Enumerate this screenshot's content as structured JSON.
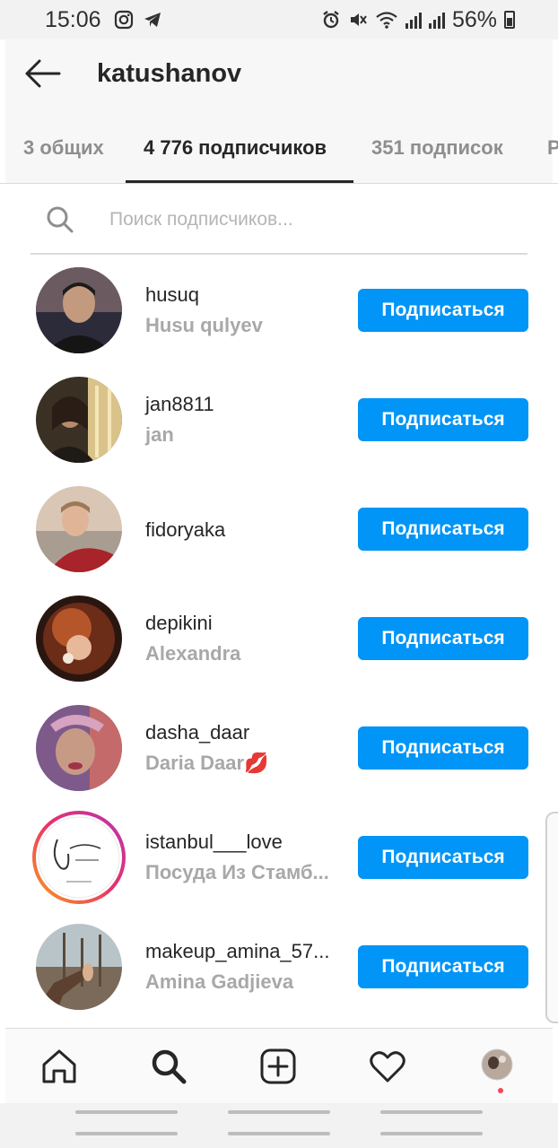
{
  "status_bar": {
    "time": "15:06",
    "battery": "56%"
  },
  "header": {
    "title": "katushanov"
  },
  "tabs": [
    {
      "label": "3 общих"
    },
    {
      "label": "4 776 подписчиков"
    },
    {
      "label": "351 подписок"
    },
    {
      "label": "Р"
    }
  ],
  "search": {
    "placeholder": "Поиск подписчиков..."
  },
  "followers": [
    {
      "username": "husuq",
      "full_name": "Husu qulyev",
      "button": "Подписаться"
    },
    {
      "username": "jan8811",
      "full_name": "jan",
      "button": "Подписаться"
    },
    {
      "username": "fidoryaka",
      "full_name": "",
      "button": "Подписаться"
    },
    {
      "username": "depikini",
      "full_name": "Alexandra",
      "button": "Подписаться"
    },
    {
      "username": "dasha_daar",
      "full_name": "Daria Daar💋",
      "button": "Подписаться"
    },
    {
      "username": "istanbul___love",
      "full_name": "Посуда Из Стамб...",
      "button": "Подписаться"
    },
    {
      "username": "makeup_amina_57...",
      "full_name": "Amina Gadjieva",
      "button": "Подписаться"
    }
  ],
  "colors": {
    "accent": "#0095f6",
    "notification_dot": "#ed4956"
  },
  "icons": {
    "back": "arrow-left-icon",
    "search": "search-icon",
    "nav": [
      "home-icon",
      "search-icon",
      "add-post-icon",
      "heart-icon",
      "profile-avatar"
    ]
  }
}
